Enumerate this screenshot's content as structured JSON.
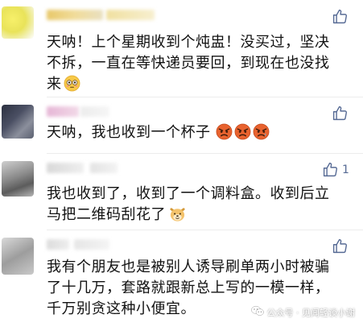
{
  "comments": [
    {
      "text_lines": [
        "天呐！上个星期收到个炖盅！没买过，坚决",
        "不拆，一直在等快递员要回，到现在也没找",
        "来"
      ],
      "like_count": ""
    },
    {
      "text_lines": [
        "天呐，我也收到一个杯子"
      ],
      "like_count": ""
    },
    {
      "text_lines": [
        "我也收到了，收到了一个调料盒。收到后立",
        "马把二维码刮花了"
      ],
      "like_count": "1"
    },
    {
      "text_lines": [
        "我有个朋友也是被别人诱导刷单两小时被骗",
        "了十几万，套路就跟新总上写的一模一样，",
        "千万别贪这种小便宜。"
      ],
      "like_count": ""
    }
  ],
  "watermark": {
    "text": "公众号 · 见闻轻谈小谢"
  },
  "colors": {
    "link_blue": "#576b95",
    "text": "#111111"
  },
  "icons": [
    "thumbs-up-icon",
    "flushed-face-icon",
    "angry-face-icon",
    "crying-angry-face-icon",
    "doge-icon",
    "wechat-logo-icon"
  ]
}
